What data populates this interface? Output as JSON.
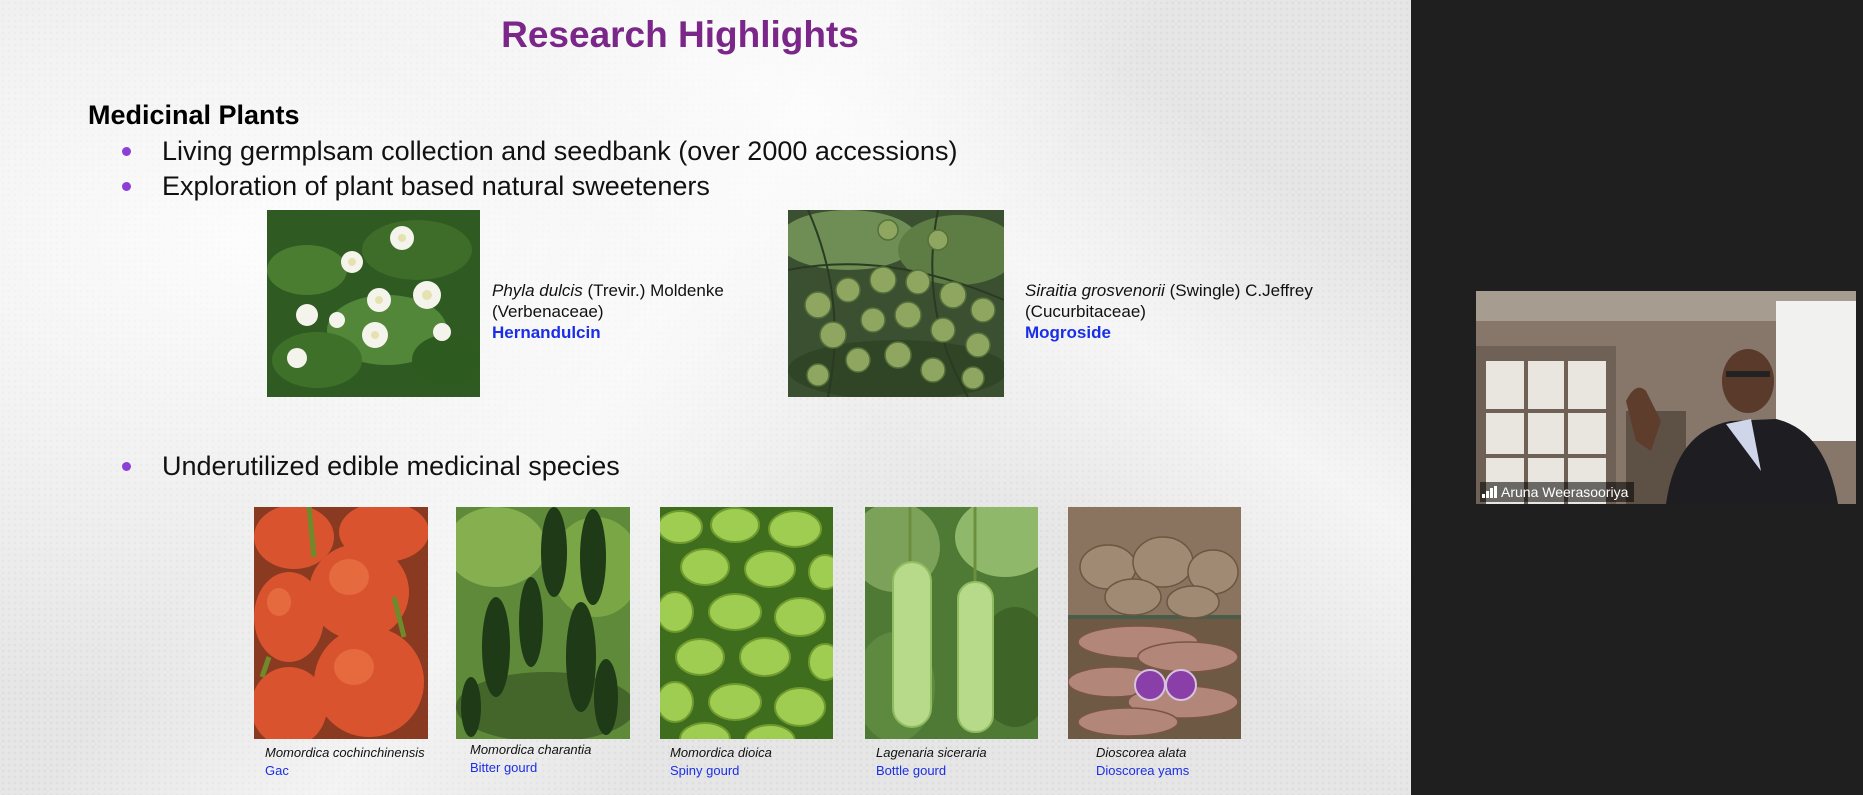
{
  "slide": {
    "title": "Research Highlights",
    "section_heading": "Medicinal Plants",
    "bullets": [
      "Living germplsam collection and seedbank (over 2000 accessions)",
      "Exploration of plant based natural sweeteners",
      "Underutilized edible medicinal species"
    ],
    "sweeteners": [
      {
        "species": "Phyla dulcis",
        "authority": " (Trevir.) Moldenke",
        "family": "(Verbenaceae)",
        "compound": "Hernandulcin"
      },
      {
        "species": "Siraitia grosvenorii",
        "authority": " (Swingle) C.Jeffrey",
        "family": "(Cucurbitaceae)",
        "compound": "Mogroside"
      }
    ],
    "species": [
      {
        "latin": "Momordica cochinchinensis",
        "common": "Gac"
      },
      {
        "latin": "Momordica charantia",
        "common": "Bitter gourd"
      },
      {
        "latin": "Momordica dioica",
        "common": "Spiny gourd"
      },
      {
        "latin": "Lagenaria siceraria",
        "common": "Bottle gourd"
      },
      {
        "latin": "Dioscorea alata",
        "common": "Dioscorea yams"
      }
    ]
  },
  "participant": {
    "name": "Aruna Weerasooriya"
  }
}
